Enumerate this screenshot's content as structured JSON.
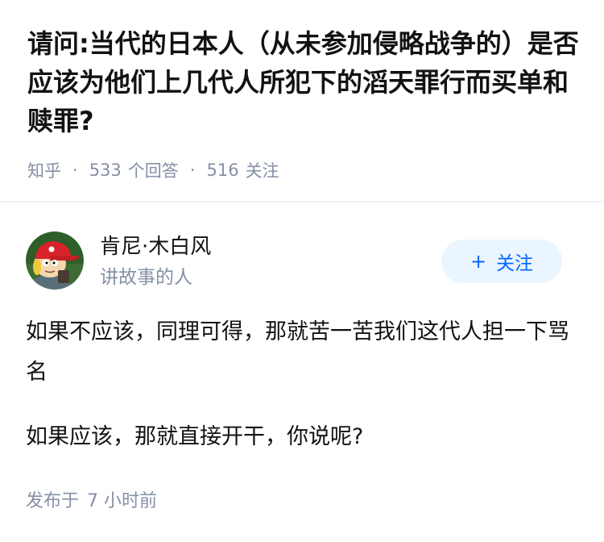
{
  "question": {
    "title": "请问:当代的日本人（从未参加侵略战争的）是否应该为他们上几代人所犯下的滔天罪行而买单和赎罪?",
    "source": "知乎",
    "answer_count": "533",
    "answer_count_label": "个回答",
    "follower_count": "516",
    "follower_count_label": "关注"
  },
  "answer": {
    "author": {
      "name": "肯尼·木白风",
      "bio": "讲故事的人",
      "avatar_icon": "cartoon-avatar-icon"
    },
    "follow_button": {
      "icon": "+",
      "label": "关注"
    },
    "paragraphs": [
      "如果不应该，同理可得，那就苦一苦我们这代人担一下骂名",
      "如果应该，那就直接开干，你说呢?"
    ],
    "publish_label": "发布于",
    "publish_time": "7 小时前"
  },
  "colors": {
    "accent": "#0066ff",
    "button_bg": "#ebf5ff",
    "meta": "#8590a6",
    "text": "#121212"
  }
}
